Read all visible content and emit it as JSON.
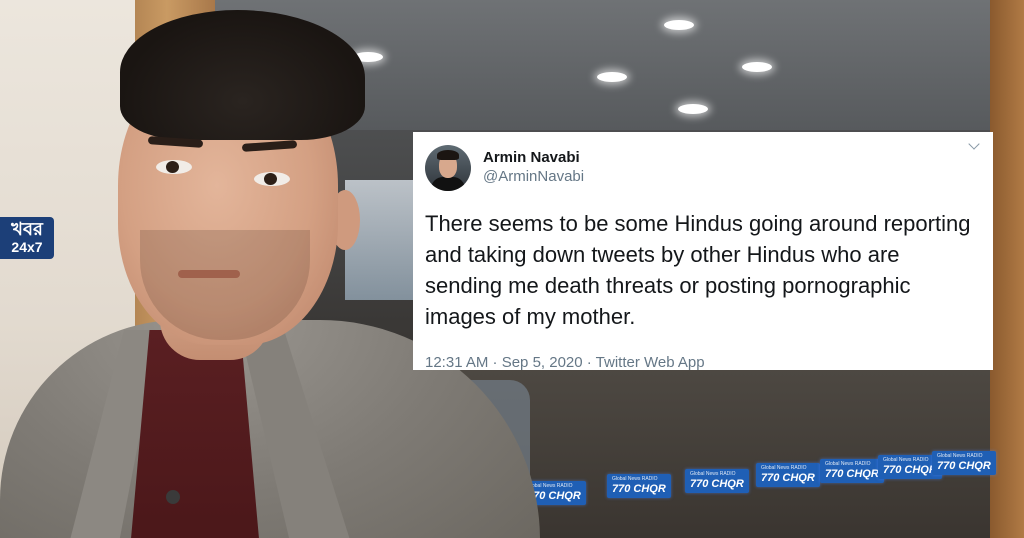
{
  "watermark": {
    "line1": "খবর",
    "line2": "24x7"
  },
  "tweet": {
    "author_name": "Armin Navabi",
    "author_handle": "@ArminNavabi",
    "text": "There seems to be some Hindus going around reporting and taking down tweets by other Hindus who are sending me death threats or posting pornographic images of my mother.",
    "meta": "12:31 AM · Sep 5, 2020 · Twitter Web App",
    "menu_icon": "chevron-down-icon",
    "avatar_icon": "profile-photo"
  },
  "background_signs": [
    "770 CHQR",
    "770 CHQR",
    "770 CHQR",
    "770 CHQR",
    "770 CHQR",
    "770 CHQR",
    "770 CHQR"
  ],
  "sign_caption": "Global News RADIO",
  "colors": {
    "watermark_bg": "#1c3f78",
    "sign_bg": "#1f5fb5",
    "tweet_bg": "#ffffff",
    "tweet_text": "#14171a",
    "tweet_secondary": "#657786"
  }
}
